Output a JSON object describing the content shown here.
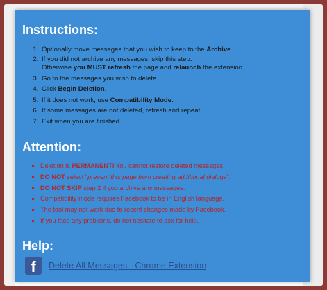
{
  "instructions": {
    "title": "Instructions:",
    "steps": [
      {
        "pre": "Optionally move messages that you wish to keep to the ",
        "bold": "Archive",
        "post": "."
      },
      {
        "line1": "If you did not archive any messages, skip this step.",
        "line2_pre": "Otherwise ",
        "line2_bold1": "you MUST refresh",
        "line2_mid": " the page and ",
        "line2_bold2": "relaunch",
        "line2_post": " the extension."
      },
      {
        "text": "Go to the messages you wish to delete."
      },
      {
        "pre": "Click ",
        "bold": "Begin Deletion",
        "post": "."
      },
      {
        "pre": "If it does not work, use ",
        "bold": "Compatibility Mode",
        "post": "."
      },
      {
        "text": "If some messages are not deleted, refresh and repeat."
      },
      {
        "text": "Exit when you are finished."
      }
    ]
  },
  "attention": {
    "title": "Attention:",
    "items": [
      {
        "pre": "Deletion is ",
        "bold": "PERMANENT!",
        "post": " You cannot restore deleted messages."
      },
      {
        "bold": "DO NOT",
        "pre": " select \"",
        "italic": "prevent this page from creating additional dialogs",
        "post": "\"."
      },
      {
        "bold": "DO NOT SKIP",
        "post": " step 2 if you archive any messages."
      },
      {
        "text": "Compatibility mode requires Facebook to be in English language."
      },
      {
        "text": "The tool may not work due to recent changes made by Facebook."
      },
      {
        "text": "If you face any problems, do not hesitate to ask for help."
      }
    ]
  },
  "help": {
    "title": "Help:",
    "link_text": "Delete All Messages - Chrome Extension",
    "icon": "facebook-icon",
    "icon_glyph": "f"
  },
  "colors": {
    "modal_bg": "#3d8ed6",
    "frame": "#8c3a36",
    "attention_text": "#b3262b",
    "link": "#2a4f8c"
  }
}
